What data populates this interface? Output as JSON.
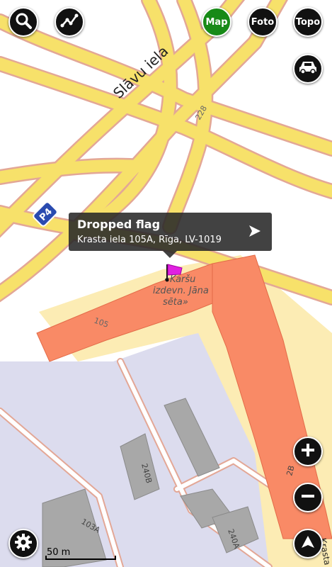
{
  "top_toolbar": {
    "search_icon": "search-icon",
    "route_icon": "route-icon",
    "map_label": "Map",
    "foto_label": "Foto",
    "topo_label": "Topo",
    "car_icon": "car-icon"
  },
  "map": {
    "street_label": "Slāvu iela",
    "road_shield": "P4",
    "house_number_228": "228",
    "house_number_105": "105",
    "house_number_240b": "240B",
    "house_number_103a": "103A",
    "house_number_240a": "240A",
    "house_number_2b": "2B",
    "poi_line1": "«Karšu",
    "poi_line2": "izdevn. Jāna",
    "poi_line3": "sēta»",
    "edge_street": "Krasta",
    "colors": {
      "road_fill": "#f7e16a",
      "road_outline": "#e8a08c",
      "building": "#f98a66",
      "area_lightyellow": "#fcecb4",
      "industrial": "#d9d9ec",
      "dark_building": "#9a9a9a",
      "flag": "#e020e0"
    }
  },
  "popup": {
    "title": "Dropped flag",
    "address": "Krasta iela 105A, Rīga, LV-1019"
  },
  "controls": {
    "zoom_in_icon": "plus-icon",
    "zoom_out_icon": "minus-icon",
    "compass_icon": "navigation-arrow-icon",
    "settings_icon": "gear-icon"
  },
  "scale": {
    "label": "50 m"
  }
}
